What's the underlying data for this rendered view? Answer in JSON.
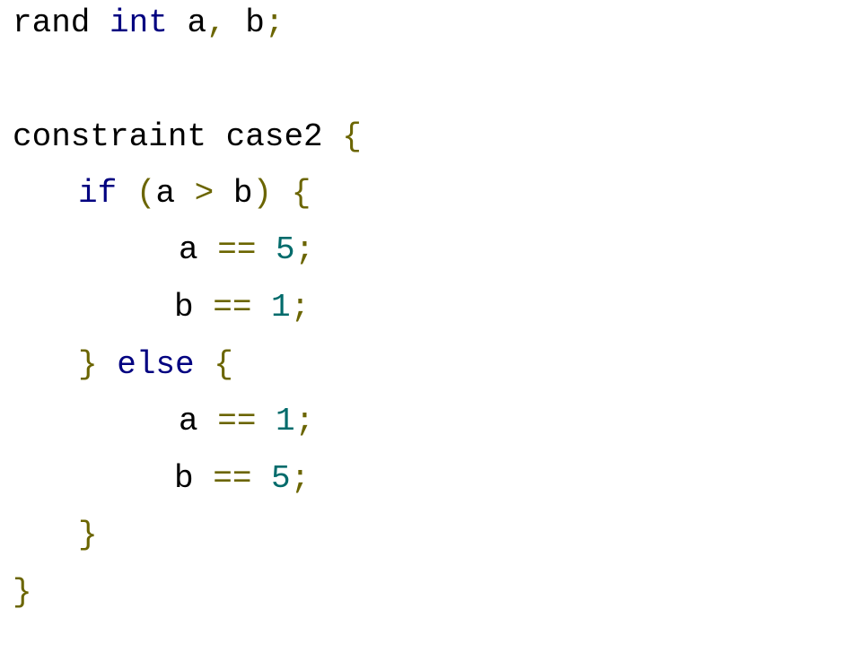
{
  "code": {
    "colors": {
      "keyword": "#000080",
      "punctuation": "#6b6500",
      "number": "#006b6b",
      "identifier": "#000000"
    },
    "lines": [
      {
        "tokens": [
          {
            "t": "rand ",
            "k": "id"
          },
          {
            "t": "int",
            "k": "kw"
          },
          {
            "t": " a",
            "k": "id"
          },
          {
            "t": ",",
            "k": "pn"
          },
          {
            "t": " b",
            "k": "id"
          },
          {
            "t": ";",
            "k": "pn"
          }
        ]
      },
      {
        "tokens": [
          {
            "t": "constraint case2 ",
            "k": "id"
          },
          {
            "t": "{",
            "k": "pn"
          }
        ]
      },
      {
        "tokens": [
          {
            "t": "if",
            "k": "kw"
          },
          {
            "t": " (",
            "k": "pn"
          },
          {
            "t": "a ",
            "k": "id"
          },
          {
            "t": ">",
            "k": "pn"
          },
          {
            "t": " b",
            "k": "id"
          },
          {
            "t": ")",
            "k": "pn"
          },
          {
            "t": " {",
            "k": "pn"
          }
        ]
      },
      {
        "tokens": [
          {
            "t": "a ",
            "k": "id"
          },
          {
            "t": "==",
            "k": "pn"
          },
          {
            "t": " 5",
            "k": "num"
          },
          {
            "t": ";",
            "k": "pn"
          }
        ]
      },
      {
        "tokens": [
          {
            "t": "b ",
            "k": "id"
          },
          {
            "t": "==",
            "k": "pn"
          },
          {
            "t": " 1",
            "k": "num"
          },
          {
            "t": ";",
            "k": "pn"
          }
        ]
      },
      {
        "tokens": [
          {
            "t": "}",
            "k": "pn"
          },
          {
            "t": " else",
            "k": "kw"
          },
          {
            "t": " {",
            "k": "pn"
          }
        ]
      },
      {
        "tokens": [
          {
            "t": "a ",
            "k": "id"
          },
          {
            "t": "==",
            "k": "pn"
          },
          {
            "t": " 1",
            "k": "num"
          },
          {
            "t": ";",
            "k": "pn"
          }
        ]
      },
      {
        "tokens": [
          {
            "t": "b ",
            "k": "id"
          },
          {
            "t": "==",
            "k": "pn"
          },
          {
            "t": " 5",
            "k": "num"
          },
          {
            "t": ";",
            "k": "pn"
          }
        ]
      },
      {
        "tokens": [
          {
            "t": "}",
            "k": "pn"
          }
        ]
      },
      {
        "tokens": [
          {
            "t": "}",
            "k": "pn"
          }
        ]
      }
    ]
  }
}
